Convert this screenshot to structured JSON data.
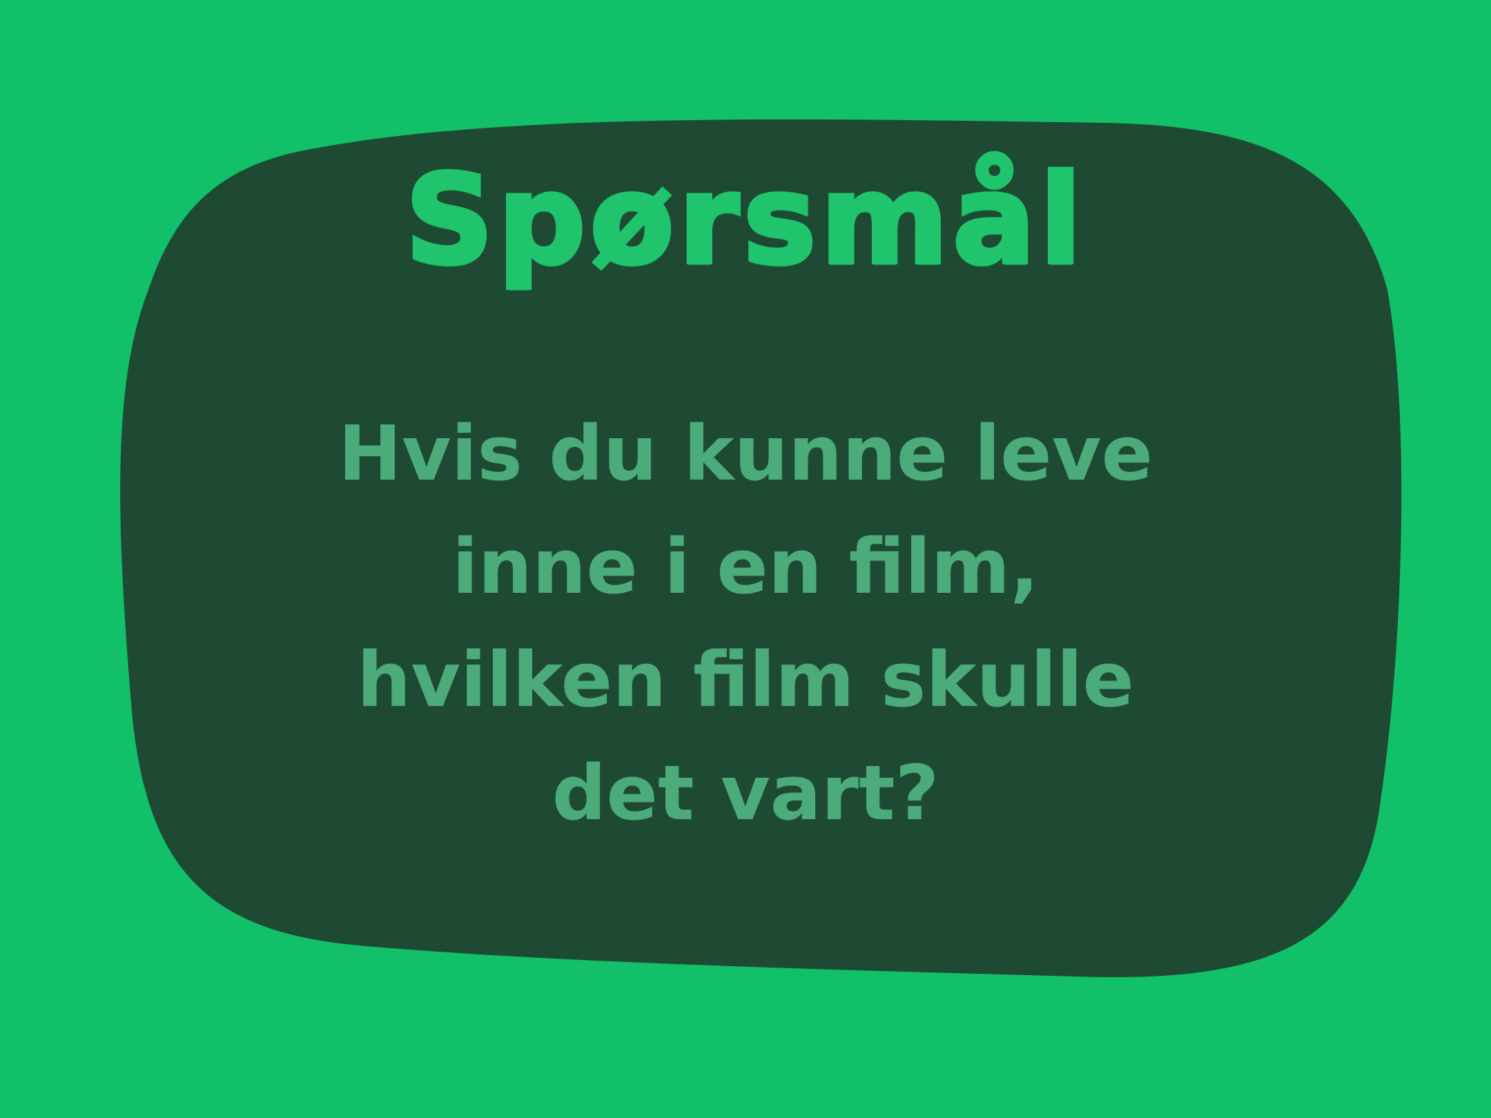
{
  "colors": {
    "background": "#13c06a",
    "card": "#1e4a33",
    "title": "#20c46d",
    "question_text": "#4bab7a"
  },
  "card": {
    "title": "Spørsmål",
    "question_lines": [
      "Hvis du kunne leve",
      "inne i en film,",
      "hvilken film skulle",
      "det vart?"
    ]
  }
}
